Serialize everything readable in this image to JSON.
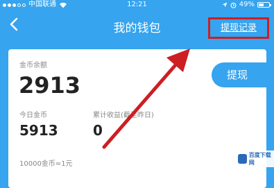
{
  "status_bar": {
    "carrier": "中国联通",
    "time": "12:21",
    "battery_text": "49%",
    "battery_level": 0.49
  },
  "nav": {
    "title": "我的钱包",
    "records_link": "提现记录"
  },
  "wallet": {
    "balance_label": "金币余额",
    "balance_value": "2913",
    "today_label": "今日金币",
    "today_value": "5913",
    "cumulative_label": "累计收益(截至昨日)",
    "cumulative_value": "0",
    "rate_note": "10000金币≈1元"
  },
  "withdraw_button": "提现",
  "watermark": "百度下载网",
  "colors": {
    "primary_blue": "#36a4ee",
    "annotation_red": "#cc1f24"
  }
}
